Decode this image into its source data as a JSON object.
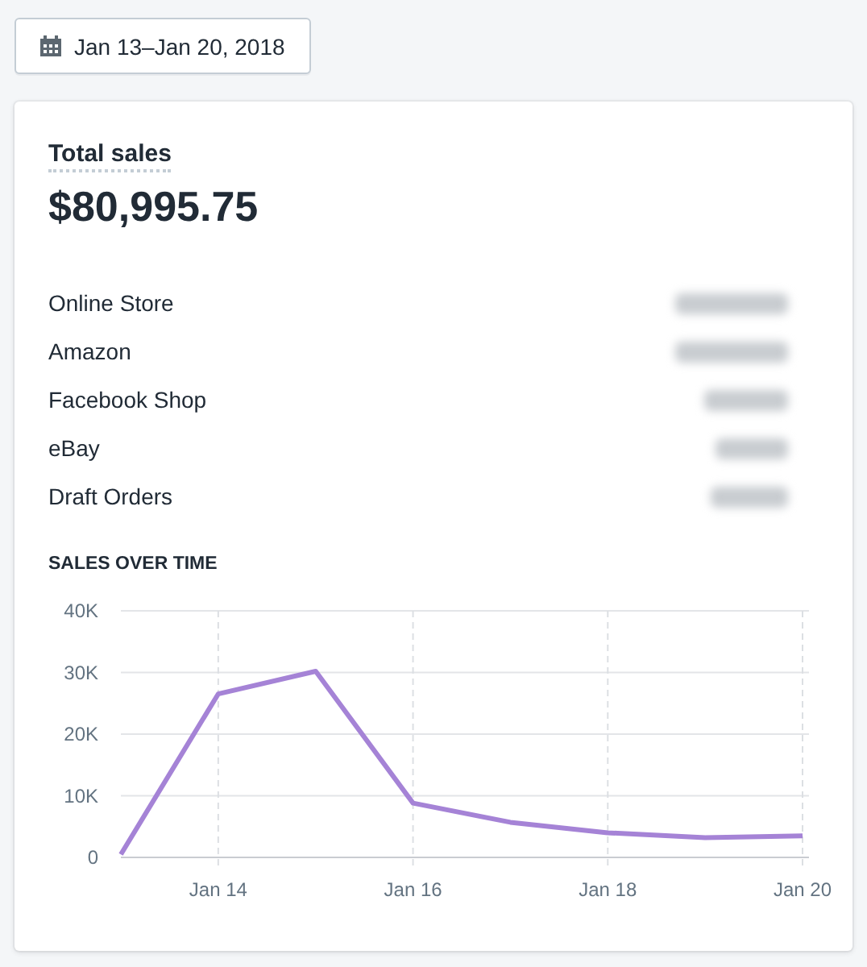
{
  "date_range_button": {
    "label": "Jan 13–Jan 20, 2018"
  },
  "total_sales": {
    "title": "Total sales",
    "amount": "$80,995.75",
    "channels": [
      {
        "name": "Online Store"
      },
      {
        "name": "Amazon"
      },
      {
        "name": "Facebook Shop"
      },
      {
        "name": "eBay"
      },
      {
        "name": "Draft Orders"
      }
    ]
  },
  "sales_over_time": {
    "title": "SALES OVER TIME",
    "chart_data": {
      "type": "line",
      "categories": [
        null,
        "Jan 14",
        null,
        "Jan 16",
        null,
        "Jan 18",
        null,
        "Jan 20"
      ],
      "series": [
        {
          "color": "#a583d6",
          "values": [
            500,
            26500,
            30200,
            8800,
            5700,
            4000,
            3200,
            3500
          ]
        }
      ],
      "ylim": [
        0,
        40000
      ],
      "grid": true,
      "yticks": [
        {
          "value": 0,
          "label": "0"
        },
        {
          "value": 10000,
          "label": "10K"
        },
        {
          "value": 20000,
          "label": "20K"
        },
        {
          "value": 30000,
          "label": "30K"
        },
        {
          "value": 40000,
          "label": "40K"
        }
      ]
    }
  }
}
